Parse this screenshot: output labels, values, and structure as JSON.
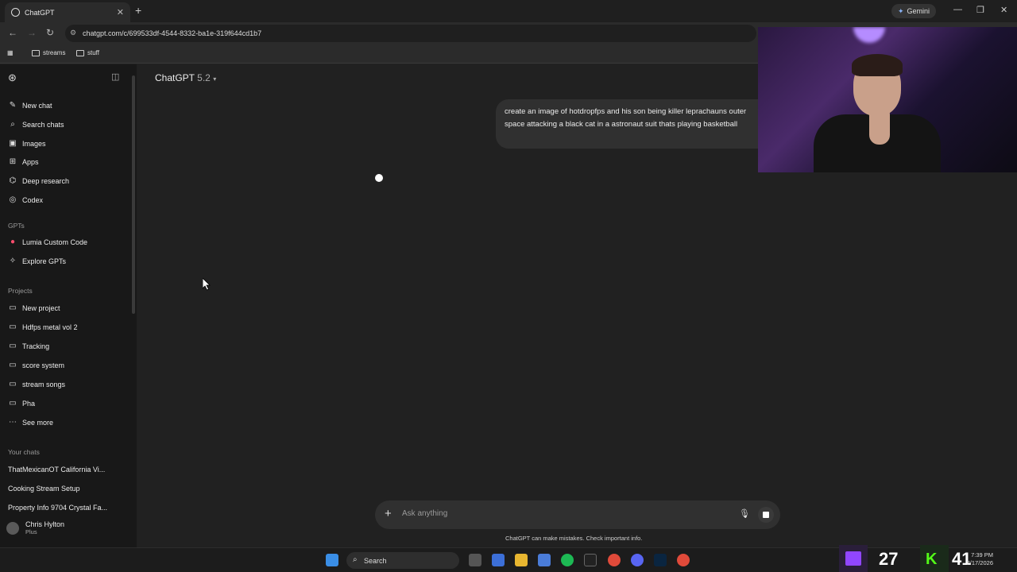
{
  "browser": {
    "tab_title": "ChatGPT",
    "url": "chatgpt.com/c/699533df-4544-8332-ba1e-319f644cd1b7",
    "gemini_label": "Gemini",
    "bookmarks": [
      "streams",
      "stuff"
    ]
  },
  "sidebar": {
    "nav": [
      {
        "label": "New chat",
        "icon": "edit-icon"
      },
      {
        "label": "Search chats",
        "icon": "search-icon"
      },
      {
        "label": "Images",
        "icon": "image-icon"
      },
      {
        "label": "Apps",
        "icon": "apps-icon"
      },
      {
        "label": "Deep research",
        "icon": "research-icon"
      },
      {
        "label": "Codex",
        "icon": "codex-icon"
      }
    ],
    "gpts_header": "GPTs",
    "gpts": [
      {
        "label": "Lumia Custom Code",
        "icon": "lumia-icon"
      },
      {
        "label": "Explore GPTs",
        "icon": "explore-icon"
      }
    ],
    "projects_header": "Projects",
    "projects": [
      {
        "label": "New project",
        "icon": "new-folder-icon"
      },
      {
        "label": "Hdfps metal vol 2",
        "icon": "folder-icon"
      },
      {
        "label": "Tracking",
        "icon": "folder-icon"
      },
      {
        "label": "score system",
        "icon": "folder-icon"
      },
      {
        "label": "stream songs",
        "icon": "folder-icon"
      },
      {
        "label": "Pha",
        "icon": "folder-icon"
      }
    ],
    "see_more": "See more",
    "chats_header": "Your chats",
    "chats": [
      "ThatMexicanOT California Vi...",
      "Cooking Stream Setup",
      "Property Info 9704 Crystal Fa..."
    ],
    "user": {
      "name": "Chris Hylton",
      "plan": "Plus"
    }
  },
  "main": {
    "model_name": "ChatGPT",
    "model_version": "5.2",
    "user_message": "create an image of hotdropfps and his son being killer leprachauns outer space attacking a black cat in a astronaut suit thats playing basketball",
    "composer_placeholder": "Ask anything",
    "disclaimer": "ChatGPT can make mistakes. Check important info."
  },
  "taskbar": {
    "search_label": "Search",
    "viewer_count_twitch": "27",
    "viewer_count_kick": "41",
    "time": "7:39 PM",
    "date": "2/17/2026"
  },
  "colors": {
    "background": "#212121",
    "sidebar": "#181818",
    "message_bubble": "#303030",
    "twitch": "#9146ff",
    "kick": "#53fc18"
  }
}
